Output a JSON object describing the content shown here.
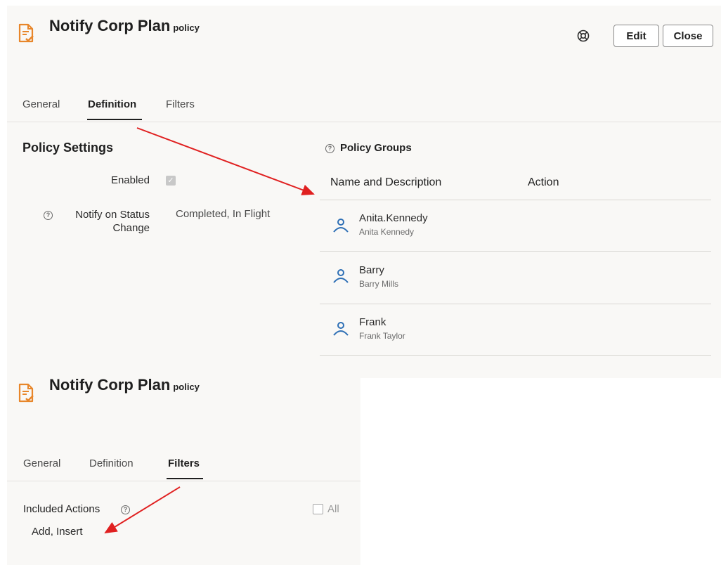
{
  "top": {
    "title": "Notify Corp Plan",
    "title_suffix": "policy",
    "toolbar": {
      "edit_label": "Edit",
      "close_label": "Close",
      "help_icon": "lifebuoy-icon"
    },
    "tabs": [
      {
        "label": "General",
        "active": false
      },
      {
        "label": "Definition",
        "active": true
      },
      {
        "label": "Filters",
        "active": false
      }
    ],
    "policy_settings": {
      "heading": "Policy Settings",
      "enabled_label": "Enabled",
      "enabled_checked": true,
      "notify_label_line1": "Notify on Status",
      "notify_label_line2": "Change",
      "notify_value": "Completed, In Flight"
    },
    "policy_groups": {
      "heading": "Policy Groups",
      "columns": [
        "Name and Description",
        "Action"
      ],
      "rows": [
        {
          "name": "Anita.Kennedy",
          "description": "Anita Kennedy"
        },
        {
          "name": "Barry",
          "description": "Barry Mills"
        },
        {
          "name": "Frank",
          "description": "Frank Taylor"
        }
      ]
    }
  },
  "bottom": {
    "title": "Notify Corp Plan",
    "title_suffix": "policy",
    "tabs": [
      {
        "label": "General",
        "active": false
      },
      {
        "label": "Definition",
        "active": false
      },
      {
        "label": "Filters",
        "active": true
      }
    ],
    "included_actions_label": "Included Actions",
    "all_label": "All",
    "all_checked": false,
    "included_actions_value": "Add, Insert"
  },
  "colors": {
    "accent_orange": "#e8862a",
    "person_blue": "#2e6fb5",
    "arrow_red": "#e02020"
  }
}
